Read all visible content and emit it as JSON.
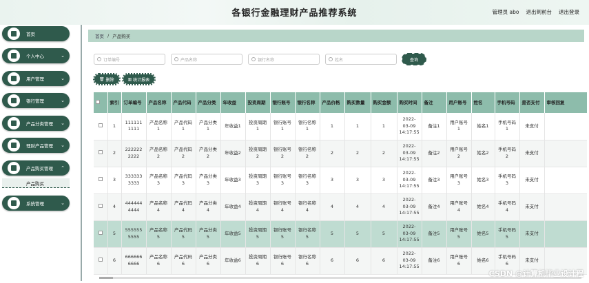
{
  "header": {
    "title": "各银行金融理财产品推荐系统",
    "admin": "管理员 abo",
    "front": "退出到前台",
    "logout": "退出登录"
  },
  "sidebar": {
    "items": [
      {
        "label": "首页",
        "chev": ""
      },
      {
        "label": "个人中心",
        "chev": "⌄"
      },
      {
        "label": "用户管理",
        "chev": "⌄"
      },
      {
        "label": "银行管理",
        "chev": "⌄"
      },
      {
        "label": "产品分类管理",
        "chev": "⌄"
      },
      {
        "label": "理财产品管理",
        "chev": "⌄"
      },
      {
        "label": "产品购买管理",
        "chev": "⌃"
      },
      {
        "label": "系统管理",
        "chev": "⌄"
      }
    ],
    "sub": "产品购买"
  },
  "crumb": {
    "home": "首页",
    "sep": "/",
    "current": "产品购买"
  },
  "search": {
    "order": "订单编号",
    "product": "产品名称",
    "bank": "银行名称",
    "name": "姓名",
    "button": "查询"
  },
  "actions": {
    "delete": "删除",
    "report": "统计报表"
  },
  "table": {
    "headers": [
      "",
      "索引",
      "订单编号",
      "产品名称",
      "产品代码",
      "产品分类",
      "年收益",
      "投资周期",
      "银行账号",
      "银行名称",
      "产品价格",
      "购买数量",
      "购买金额",
      "购买时间",
      "备注",
      "用户账号",
      "姓名",
      "手机号码",
      "是否支付",
      "审核回复"
    ],
    "rows": [
      [
        "1",
        "111111 1111",
        "产品名称1",
        "产品代码1",
        "产品分类1",
        "年收益1",
        "投资周期1",
        "银行账号1",
        "银行名称1",
        "1",
        "1",
        "1",
        "2022-03-09 14:17:55",
        "备注1",
        "用户账号1",
        "姓名1",
        "手机号码1",
        "未支付",
        ""
      ],
      [
        "2",
        "222222 2222",
        "产品名称2",
        "产品代码2",
        "产品分类2",
        "年收益2",
        "投资周期2",
        "银行账号2",
        "银行名称2",
        "2",
        "2",
        "2",
        "2022-03-09 14:17:55",
        "备注2",
        "用户账号2",
        "姓名2",
        "手机号码2",
        "未支付",
        ""
      ],
      [
        "3",
        "333333 3333",
        "产品名称3",
        "产品代码3",
        "产品分类3",
        "年收益3",
        "投资周期3",
        "银行账号3",
        "银行名称3",
        "3",
        "3",
        "3",
        "2022-03-09 14:17:55",
        "备注3",
        "用户账号3",
        "姓名3",
        "手机号码3",
        "未支付",
        ""
      ],
      [
        "4",
        "444444 4444",
        "产品名称4",
        "产品代码4",
        "产品分类4",
        "年收益4",
        "投资周期4",
        "银行账号4",
        "银行名称4",
        "4",
        "4",
        "4",
        "2022-03-09 14:17:55",
        "备注4",
        "用户账号4",
        "姓名4",
        "手机号码4",
        "未支付",
        ""
      ],
      [
        "5",
        "555555 5555",
        "产品名称5",
        "产品代码5",
        "产品分类5",
        "年收益5",
        "投资周期5",
        "银行账号5",
        "银行名称5",
        "5",
        "5",
        "5",
        "2022-03-09 14:17:55",
        "备注5",
        "用户账号5",
        "姓名5",
        "手机号码5",
        "未支付",
        ""
      ],
      [
        "6",
        "666666 6666",
        "产品名称6",
        "产品代码6",
        "产品分类6",
        "年收益6",
        "投资周期6",
        "银行账号6",
        "银行名称6",
        "6",
        "6",
        "6",
        "2022-03-09 14:17:55",
        "备注6",
        "用户账号6",
        "姓名6",
        "手机号码6",
        "未支付",
        ""
      ]
    ]
  },
  "watermark": "CSDN @计算机毕业设计程"
}
